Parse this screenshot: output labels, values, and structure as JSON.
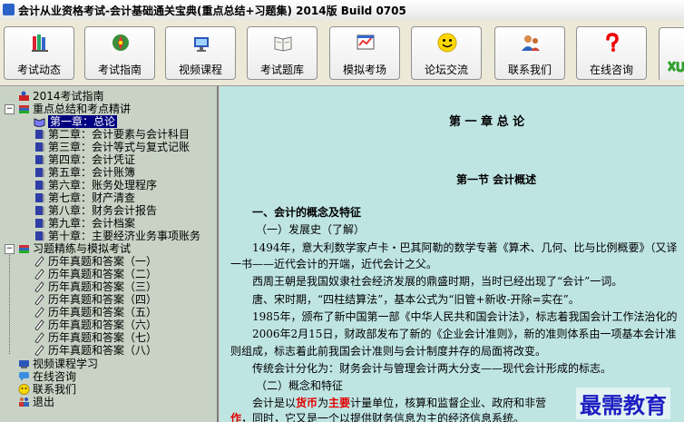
{
  "window": {
    "title": "会计从业资格考试-会计基础通关宝典(重点总结+习题集) 2014版 Build 0705"
  },
  "toolbar": {
    "buttons": [
      {
        "label": "考试动态",
        "icon": "books-icon"
      },
      {
        "label": "考试指南",
        "icon": "compass-icon"
      },
      {
        "label": "视频课程",
        "icon": "video-icon"
      },
      {
        "label": "考试题库",
        "icon": "question-bank-icon"
      },
      {
        "label": "模拟考场",
        "icon": "exam-hall-icon"
      },
      {
        "label": "论坛交流",
        "icon": "smiley-icon"
      },
      {
        "label": "联系我们",
        "icon": "contacts-icon"
      },
      {
        "label": "在线咨询",
        "icon": "question-mark-icon"
      }
    ],
    "partial_icon": "xu-logo-icon"
  },
  "sidebar": {
    "items": [
      {
        "label": "2014考试指南",
        "level": 0
      },
      {
        "label": "重点总结和考点精讲",
        "level": 0
      },
      {
        "label": "第一章：总论",
        "level": 1,
        "selected": true
      },
      {
        "label": "第二章：会计要素与会计科目",
        "level": 1
      },
      {
        "label": "第三章：会计等式与复式记账",
        "level": 1
      },
      {
        "label": "第四章：会计凭证",
        "level": 1
      },
      {
        "label": "第五章：会计账簿",
        "level": 1
      },
      {
        "label": "第六章：账务处理程序",
        "level": 1
      },
      {
        "label": "第七章：财产清查",
        "level": 1
      },
      {
        "label": "第八章：财务会计报告",
        "level": 1
      },
      {
        "label": "第九章：会计档案",
        "level": 1
      },
      {
        "label": "第十章：主要经济业务事项账务",
        "level": 1
      },
      {
        "label": "习题精练与模拟考试",
        "level": 0
      },
      {
        "label": "历年真题和答案（一）",
        "level": 1
      },
      {
        "label": "历年真题和答案（二）",
        "level": 1
      },
      {
        "label": "历年真题和答案（三）",
        "level": 1
      },
      {
        "label": "历年真题和答案（四）",
        "level": 1
      },
      {
        "label": "历年真题和答案（五）",
        "level": 1
      },
      {
        "label": "历年真题和答案（六）",
        "level": 1
      },
      {
        "label": "历年真题和答案（七）",
        "level": 1
      },
      {
        "label": "历年真题和答案（八）",
        "level": 1
      },
      {
        "label": "视频课程学习",
        "level": 0
      },
      {
        "label": "在线咨询",
        "level": 0
      },
      {
        "label": "联系我们",
        "level": 0
      },
      {
        "label": "退出",
        "level": 0
      }
    ]
  },
  "content": {
    "chapter_title": "第 一 章  总  论",
    "section_title": "第一节   会计概述",
    "heading1": "一、会计的概念及特征",
    "sub1": "（一）发展史（了解）",
    "p1a": "1494年，意大利数学家卢卡・巴其阿勒的数学专著《算术、几何、比与比例概要》（又译",
    "p1b": "一书——近代会计的开端，近代会计之父。",
    "p2": "西周王朝是我国奴隶社会经济发展的鼎盛时期，当时已经出现了“会计”一词。",
    "p3": "唐、宋时期，“四柱结算法”，基本公式为“旧管+新收-开除=实在”。",
    "p4": "1985年，颁布了新中国第一部《中华人民共和国会计法》，标志着我国会计工作法治化的",
    "p5a": "2006年2月15日，财政部发布了新的《企业会计准则》，新的准则体系由一项基本会计准",
    "p5b": "则组成，标志着此前我国会计准则与会计制度并存的局面将改变。",
    "p6": "传统会计分化为：财务会计与管理会计两大分支——现代会计形成的标志。",
    "sub2": "（二）概念和特征",
    "p7_pre": "会计是以",
    "p7_red1": "货币",
    "p7_mid": "为",
    "p7_red2": "主要",
    "p7_post": "计量单位，核算和监督企业、政府和非营",
    "p8_red": "作",
    "p8_post": "，同时，它又是一个以提供财务信息为主的经济信息系统。",
    "watermark": "最需教育"
  }
}
